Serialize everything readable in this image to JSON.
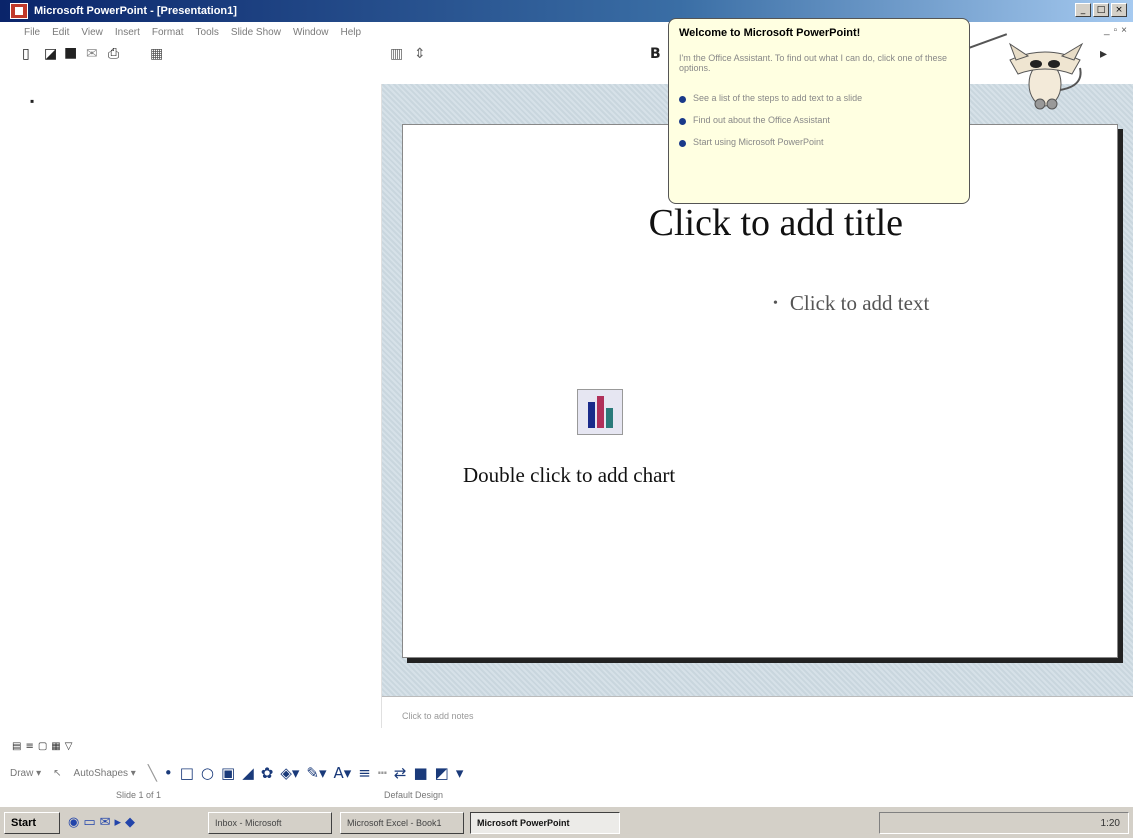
{
  "window": {
    "title": "Microsoft PowerPoint - [Presentation1]",
    "min": "_",
    "max": "□",
    "close": "×"
  },
  "menu": {
    "items": [
      "File",
      "Edit",
      "View",
      "Insert",
      "Format",
      "Tools",
      "Slide Show",
      "Window",
      "Help"
    ]
  },
  "slide": {
    "title_placeholder": "Click to add title",
    "text_placeholder": "Click to add text",
    "bullet": "•",
    "chart_placeholder": "Double click to add chart"
  },
  "notes": {
    "placeholder": "Click to add notes"
  },
  "drawing": {
    "draw_label": "Draw ▾",
    "autoshapes_label": "AutoShapes ▾"
  },
  "status": {
    "slide_indicator": "Slide 1 of 1",
    "design": "Default Design"
  },
  "taskbar": {
    "start_label": "Start",
    "buttons": [
      {
        "label": "Inbox - Microsoft"
      },
      {
        "label": "Microsoft Excel - Book1"
      },
      {
        "label": "Microsoft PowerPoint"
      }
    ],
    "clock": "1:20"
  },
  "assistant": {
    "title": "Welcome to Microsoft PowerPoint!",
    "subtitle": "I'm the Office Assistant. To find out what I can do, click one of these options.",
    "options": [
      "See a list of the steps to add text to a slide",
      "Find out about the Office Assistant",
      "Start using Microsoft PowerPoint"
    ]
  },
  "colors": {
    "titlebar_start": "#0a246a",
    "slide_area": "#c9d6de",
    "assistant_bg": "#ffffe1",
    "chart_bar_blue": "#1a2a8a",
    "chart_bar_red": "#b0305a",
    "chart_bar_teal": "#2a7a7a"
  }
}
